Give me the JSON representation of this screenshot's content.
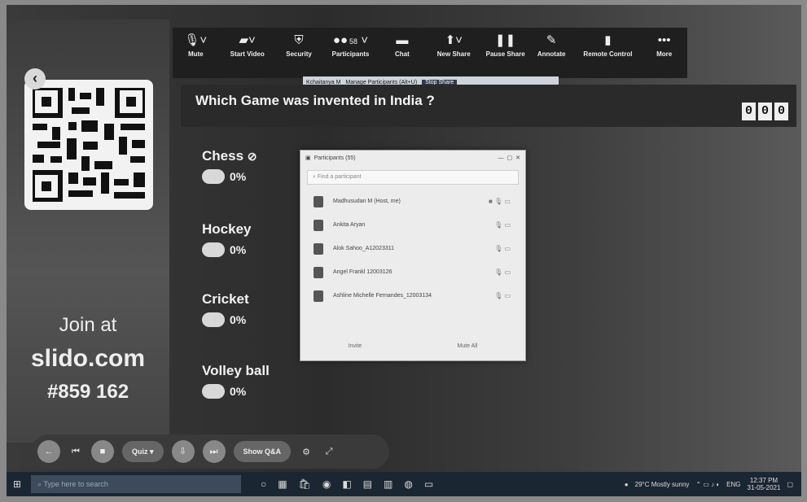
{
  "toolbar": {
    "items": [
      {
        "label": "Mute",
        "icon": "microphone-icon"
      },
      {
        "label": "Start Video",
        "icon": "video-icon"
      },
      {
        "label": "Security",
        "icon": "shield-icon"
      },
      {
        "label": "Participants",
        "icon": "participants-icon",
        "count": "58"
      },
      {
        "label": "Chat",
        "icon": "chat-icon"
      },
      {
        "label": "New Share",
        "icon": "share-icon"
      },
      {
        "label": "Pause Share",
        "icon": "pause-icon"
      },
      {
        "label": "Annotate",
        "icon": "pen-icon"
      },
      {
        "label": "Remote Control",
        "icon": "mouse-icon"
      },
      {
        "label": "More",
        "icon": "more-icon"
      }
    ],
    "share_strip": {
      "host": "Kchaitanya M",
      "tooltip": "Manage Participants (Alt+U)",
      "stop": "Stop Share"
    }
  },
  "left_panel": {
    "join_label": "Join at",
    "site": "slido.com",
    "code": "#859 162"
  },
  "question": {
    "text": "Which Game was invented in India ?",
    "counter": [
      "0",
      "0",
      "0"
    ]
  },
  "options": [
    {
      "name": "Chess",
      "percent": "0%",
      "correct": true
    },
    {
      "name": "Hockey",
      "percent": "0%"
    },
    {
      "name": "Cricket",
      "percent": "0%"
    },
    {
      "name": "Volley ball",
      "percent": "0%"
    }
  ],
  "participants_window": {
    "title": "Participants (55)",
    "search_placeholder": "Find a participant",
    "rows": [
      {
        "name": "Madhusudan M (Host, me)"
      },
      {
        "name": "Ankita Aryan"
      },
      {
        "name": "Alok Sahoo_A12023311"
      },
      {
        "name": "Angel Frankl 12003126"
      },
      {
        "name": "Ashline Michelle Fernandes_12003134"
      }
    ],
    "footer": {
      "invite": "Invite",
      "mute_all": "Mute All"
    }
  },
  "slido_bar": {
    "mode": "Quiz",
    "show_qa": "Show Q&A"
  },
  "taskbar": {
    "search_placeholder": "Type here to search",
    "weather": "29°C  Mostly sunny",
    "lang": "ENG",
    "time": "12:37 PM",
    "date": "31-05-2021"
  },
  "colors": {
    "background": "#2c2c2c",
    "toolbar": "#1f1f1f",
    "taskbar": "#1b2633"
  }
}
